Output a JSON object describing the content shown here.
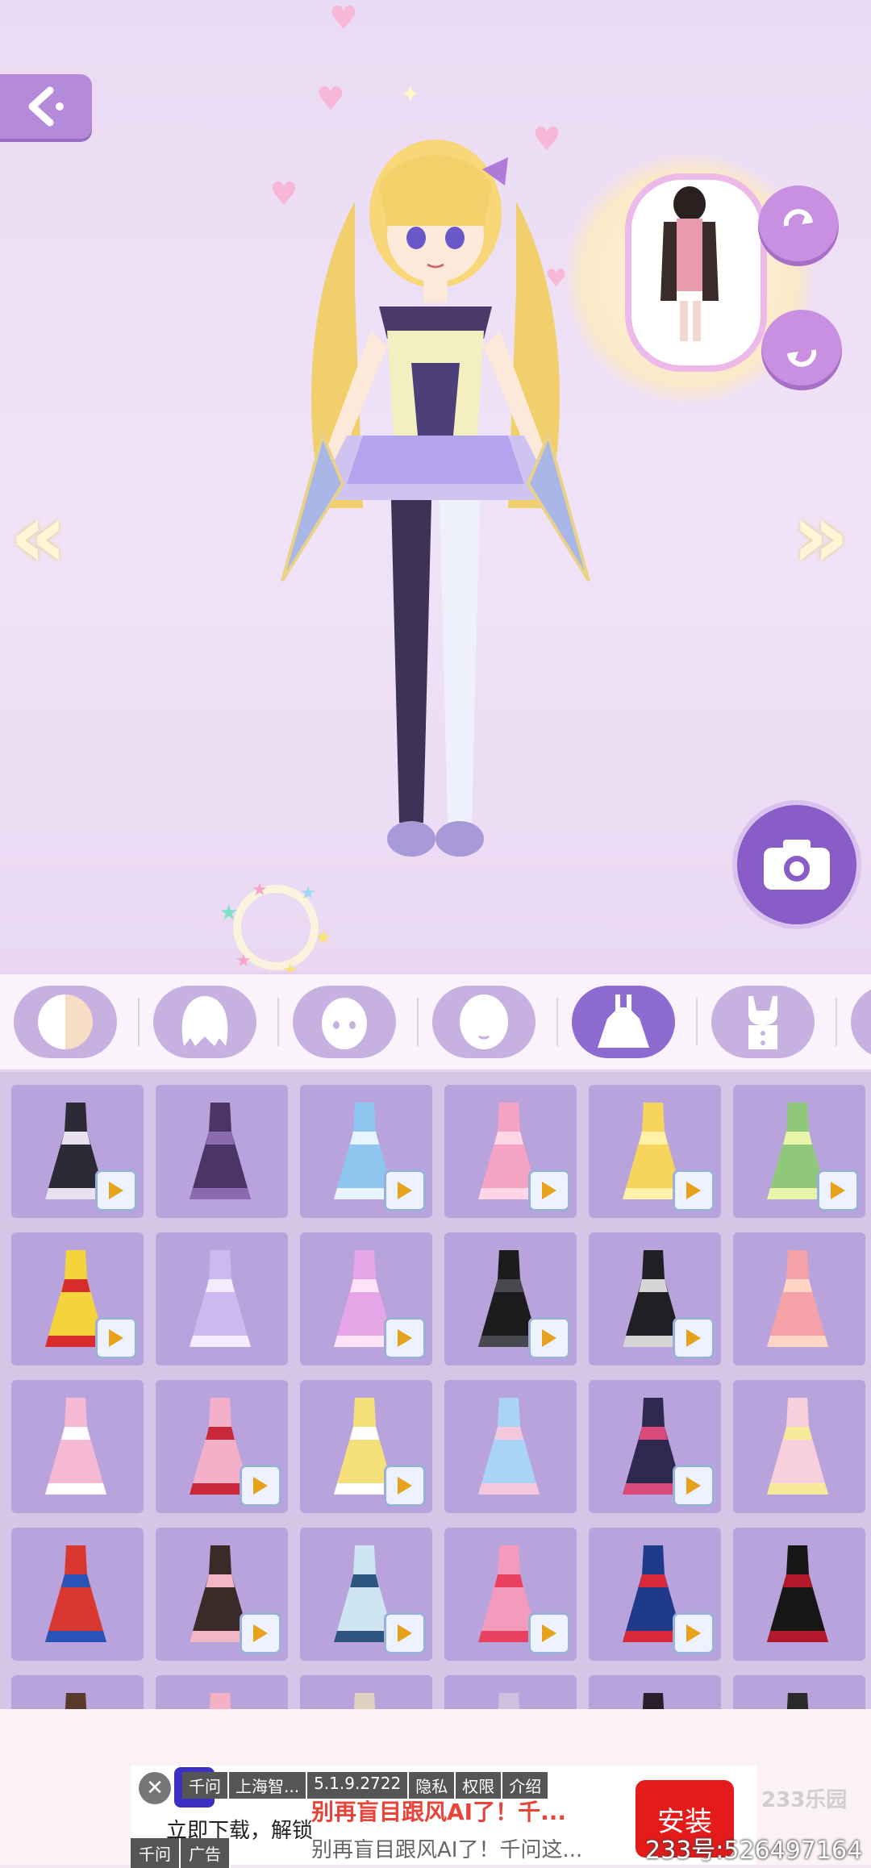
{
  "ad": {
    "close_symbol": "✕",
    "meta": [
      "千问",
      "上海智...",
      "5.1.9.2722",
      "隐私",
      "权限",
      "介绍"
    ],
    "title": "别再盲目跟风AI了！千...",
    "download_text": "立即下载，解锁",
    "subtitle": "别再盲目跟风AI了！千问这...",
    "footer": [
      "千问",
      "广告"
    ],
    "install_label": "安装"
  },
  "watermark": {
    "brand": "233乐园",
    "id": "233号:526497164"
  },
  "categories": [
    {
      "icon": "skin-tone-icon",
      "active": false
    },
    {
      "icon": "hair-icon",
      "active": false
    },
    {
      "icon": "face-icon",
      "active": false
    },
    {
      "icon": "head-icon",
      "active": false
    },
    {
      "icon": "dress-icon",
      "active": true
    },
    {
      "icon": "top-icon",
      "active": false
    },
    {
      "icon": "more-icon",
      "active": false
    }
  ],
  "outfits": [
    {
      "color": "#2d2a38",
      "accent": "#e8e2ee",
      "video": true
    },
    {
      "color": "#4a3566",
      "accent": "#8a6bb0",
      "video": false
    },
    {
      "color": "#8ec6ef",
      "accent": "#e8f4ff",
      "video": true
    },
    {
      "color": "#f4a3c3",
      "accent": "#ffd6e6",
      "video": true
    },
    {
      "color": "#f7d55c",
      "accent": "#fff1a8",
      "video": true
    },
    {
      "color": "#8fc77b",
      "accent": "#e7f6a8",
      "video": true
    },
    {
      "color": "#f5d33a",
      "accent": "#d82b2b",
      "video": true
    },
    {
      "color": "#cdb9f0",
      "accent": "#f3ecff",
      "video": false
    },
    {
      "color": "#e6a6e8",
      "accent": "#ffe2f6",
      "video": true
    },
    {
      "color": "#1c1c1f",
      "accent": "#48484f",
      "video": true
    },
    {
      "color": "#1f1f24",
      "accent": "#d6d6d6",
      "video": true
    },
    {
      "color": "#f4a2a8",
      "accent": "#ffd6c6",
      "video": false
    },
    {
      "color": "#f6b9d3",
      "accent": "#ffffff",
      "video": false
    },
    {
      "color": "#f3b0c8",
      "accent": "#c9283a",
      "video": true
    },
    {
      "color": "#f6e07a",
      "accent": "#ffffff",
      "video": true
    },
    {
      "color": "#a9d4f6",
      "accent": "#f5c7dc",
      "video": false
    },
    {
      "color": "#2f2850",
      "accent": "#d94a7a",
      "video": true
    },
    {
      "color": "#f7d0dc",
      "accent": "#f7ea9a",
      "video": false
    },
    {
      "color": "#d8382f",
      "accent": "#2a53b8",
      "video": false
    },
    {
      "color": "#3a2a28",
      "accent": "#f2b7c5",
      "video": true
    },
    {
      "color": "#cfe6f2",
      "accent": "#2d5580",
      "video": true
    },
    {
      "color": "#f39bbd",
      "accent": "#e84060",
      "video": true
    },
    {
      "color": "#1f3a8a",
      "accent": "#d8283a",
      "video": true
    },
    {
      "color": "#161616",
      "accent": "#b3182a",
      "video": false
    },
    {
      "color": "#5a3a2a",
      "accent": "#f0e0d0",
      "video": false
    },
    {
      "color": "#f4b0c4",
      "accent": "#ffffff",
      "video": false
    },
    {
      "color": "#e0d0c0",
      "accent": "#ffffff",
      "video": false
    },
    {
      "color": "#d0c0e0",
      "accent": "#ffffff",
      "video": false
    },
    {
      "color": "#2a1e2a",
      "accent": "#ffffff",
      "video": false
    },
    {
      "color": "#2a2a2a",
      "accent": "#ffffff",
      "video": false
    }
  ]
}
